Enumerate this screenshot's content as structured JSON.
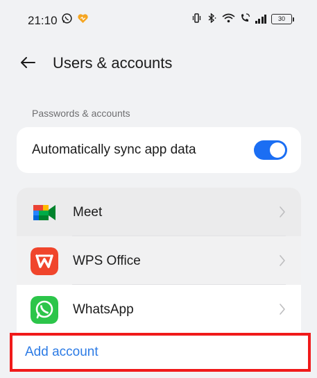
{
  "status_bar": {
    "time": "21:10",
    "battery": "30",
    "left_icons": [
      "whatsapp-status-icon",
      "heart-notification-icon"
    ],
    "right_icons": [
      "vibrate-icon",
      "bluetooth-icon",
      "wifi-icon",
      "volte-call-icon",
      "signal-icon",
      "battery-icon"
    ]
  },
  "header": {
    "title": "Users & accounts",
    "back_icon": "back-arrow-icon"
  },
  "section": {
    "label": "Passwords & accounts"
  },
  "sync": {
    "label": "Automatically sync app data",
    "enabled": true,
    "accent_color": "#1b6ef3"
  },
  "accounts": [
    {
      "name": "Meet",
      "icon": "google-meet-icon"
    },
    {
      "name": "WPS Office",
      "icon": "wps-office-icon"
    },
    {
      "name": "WhatsApp",
      "icon": "whatsapp-icon"
    }
  ],
  "add_account": {
    "label": "Add account",
    "color": "#2c7be5",
    "highlight_color": "#f01a1a"
  }
}
